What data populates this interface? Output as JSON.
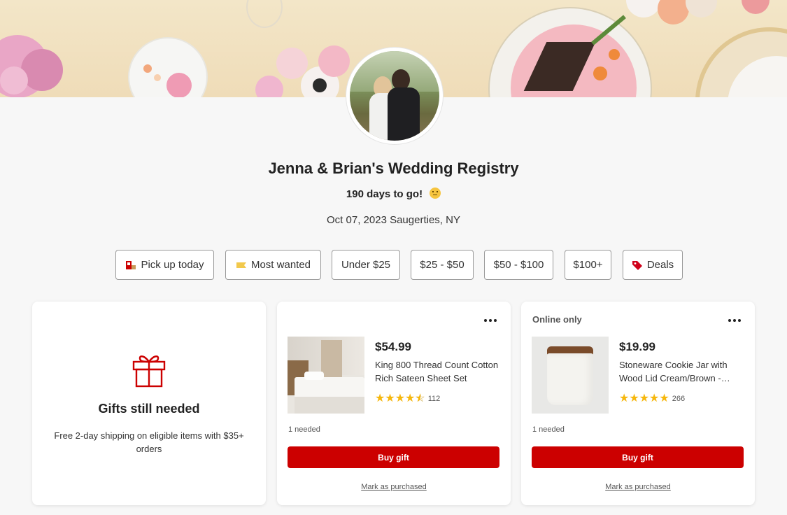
{
  "registry": {
    "title": "Jenna & Brian's Wedding Registry",
    "countdown": "190 days to go!",
    "date_location": "Oct 07, 2023 Saugerties, NY"
  },
  "filters": [
    {
      "label": "Pick up today",
      "icon": "store-pickup-icon"
    },
    {
      "label": "Most wanted",
      "icon": "ticket-icon"
    },
    {
      "label": "Under $25"
    },
    {
      "label": "$25 - $50"
    },
    {
      "label": "$50 - $100"
    },
    {
      "label": "$100+"
    },
    {
      "label": "Deals",
      "icon": "tag-icon"
    }
  ],
  "gift_card": {
    "heading": "Gifts still needed",
    "subtext": "Free 2-day shipping on eligible items with $35+ orders",
    "icon": "gift-icon"
  },
  "products": [
    {
      "badge": "",
      "price": "$54.99",
      "name": "King 800 Thread Count Cotton Rich Sateen Sheet Set",
      "rating": 4.5,
      "review_count": "112",
      "needed": "1 needed",
      "buy_label": "Buy gift",
      "mark_label": "Mark as purchased"
    },
    {
      "badge": "Online only",
      "price": "$19.99",
      "name": "Stoneware Cookie Jar with Wood Lid Cream/Brown - Hearth & Hand",
      "rating": 5,
      "review_count": "266",
      "needed": "1 needed",
      "buy_label": "Buy gift",
      "mark_label": "Mark as purchased"
    }
  ],
  "colors": {
    "accent": "#cc0000",
    "star": "#f6b70d",
    "background": "#f7f7f7"
  }
}
